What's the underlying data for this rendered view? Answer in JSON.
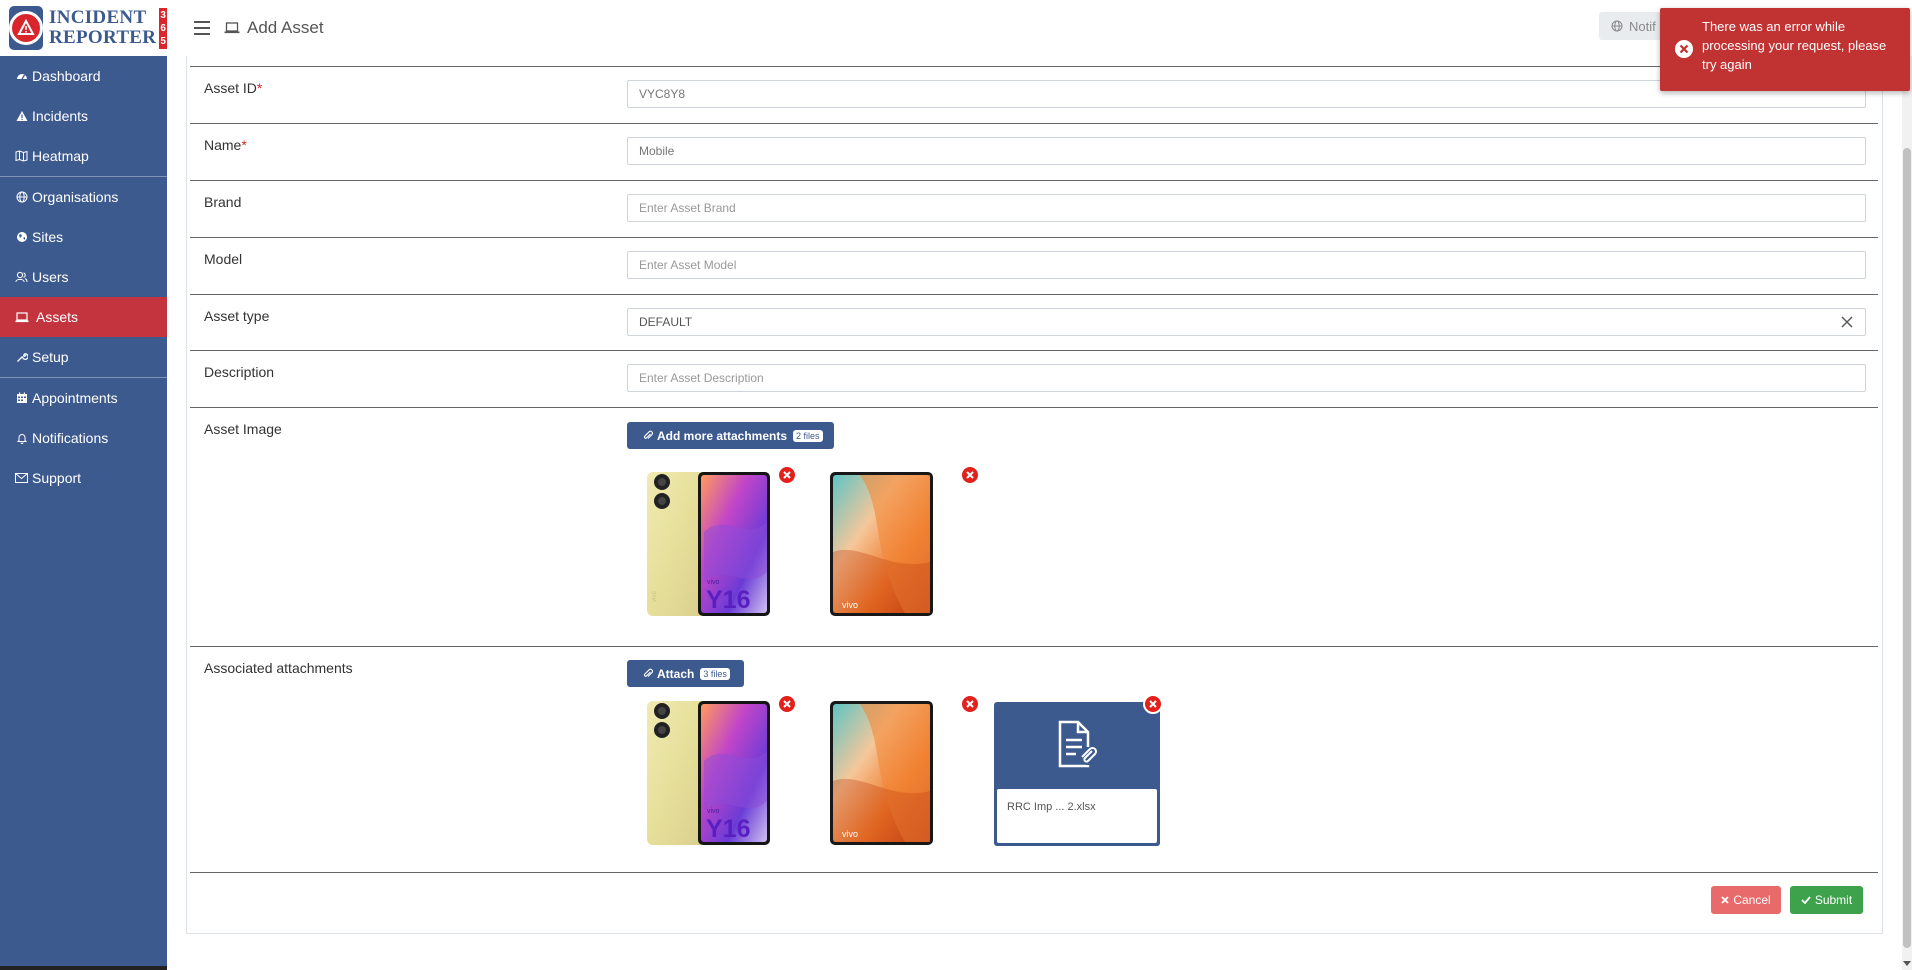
{
  "app": {
    "logo_line1": "INCIDENT",
    "logo_line2": "REPORTER",
    "logo_badge": "365"
  },
  "sidebar": {
    "items": [
      {
        "label": "Dashboard",
        "icon": "dashboard-icon"
      },
      {
        "label": "Incidents",
        "icon": "warning-icon"
      },
      {
        "label": "Heatmap",
        "icon": "map-icon"
      },
      {
        "label": "Organisations",
        "icon": "globe-icon"
      },
      {
        "label": "Sites",
        "icon": "earth-icon"
      },
      {
        "label": "Users",
        "icon": "users-icon"
      },
      {
        "label": "Assets",
        "icon": "laptop-icon",
        "active": true
      },
      {
        "label": "Setup",
        "icon": "wrench-icon"
      },
      {
        "label": "Appointments",
        "icon": "calendar-icon"
      },
      {
        "label": "Notifications",
        "icon": "bell-icon"
      },
      {
        "label": "Support",
        "icon": "envelope-icon"
      }
    ]
  },
  "header": {
    "title": "Add Asset",
    "notifications_label": "Notif"
  },
  "form": {
    "asset_id": {
      "label": "Asset ID",
      "required_mark": "*",
      "value": "VYC8Y8"
    },
    "name": {
      "label": "Name",
      "required_mark": "*",
      "value": "Mobile"
    },
    "brand": {
      "label": "Brand",
      "placeholder": "Enter Asset Brand"
    },
    "model": {
      "label": "Model",
      "placeholder": "Enter Asset Model"
    },
    "asset_type": {
      "label": "Asset type",
      "value": "DEFAULT"
    },
    "description": {
      "label": "Description",
      "placeholder": "Enter Asset Description"
    },
    "asset_image": {
      "label": "Asset Image",
      "button_label": "Add more attachments",
      "count_label": "2 files",
      "images": [
        {
          "icon": "phone-image-vivo-y16",
          "brand_text": "vivo",
          "model_text": "Y16"
        },
        {
          "icon": "phone-image-vivo-orange",
          "brand_text": "vivo"
        }
      ]
    },
    "associated": {
      "label": "Associated attachments",
      "button_label": "Attach",
      "count_label": "3 files",
      "images": [
        {
          "icon": "phone-image-vivo-y16",
          "brand_text": "vivo",
          "model_text": "Y16"
        },
        {
          "icon": "phone-image-vivo-orange",
          "brand_text": "vivo"
        }
      ],
      "document": {
        "icon": "document-attachment-icon",
        "name": "RRC Imp ... 2.xlsx"
      }
    },
    "cancel_label": "Cancel",
    "submit_label": "Submit"
  },
  "toast": {
    "message": "There was an error while processing your request, please try again"
  },
  "colors": {
    "sidebar": "#3d5a8f",
    "active": "#c4343f",
    "error": "#c13232",
    "submit": "#3ea24c",
    "cancel": "#e86a6a"
  }
}
